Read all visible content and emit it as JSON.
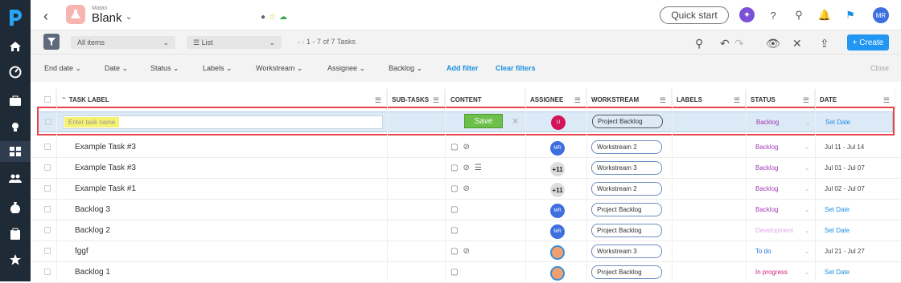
{
  "project": {
    "owner": "Matan",
    "title": "Blank"
  },
  "topbar": {
    "quick_start": "Quick start",
    "user_initials": "MR"
  },
  "toolbar": {
    "view_select": "All items",
    "layout_select": "List",
    "pager": "1 - 7 of 7 Tasks",
    "create": "+ Create"
  },
  "filters": [
    {
      "label": "End date",
      "x": 0
    },
    {
      "label": "Date"
    },
    {
      "label": "Status"
    },
    {
      "label": "Labels"
    },
    {
      "label": "Workstream"
    },
    {
      "label": "Assignee"
    },
    {
      "label": "Backlog"
    }
  ],
  "filter_links": {
    "add": "Add filter",
    "clear": "Clear filters",
    "close": "Close"
  },
  "columns": [
    "TASK LABEL",
    "SUB-TASKS",
    "CONTENT",
    "ASSIGNEE",
    "WORKSTREAM",
    "LABELS",
    "STATUS",
    "DATE"
  ],
  "new_row": {
    "placeholder": "Enter task name",
    "save": "Save",
    "assignee": "U",
    "workstream": "Project Backlog",
    "status": "Backlog",
    "date": "Set Date"
  },
  "rows": [
    {
      "name": "Example Task #3",
      "assignee": "MR",
      "workstream": "Workstream 2",
      "status": "Backlog",
      "date": "Jul 11 - Jul 14"
    },
    {
      "name": "Example Task #3",
      "assignee": "+11",
      "workstream": "Workstream 3",
      "status": "Backlog",
      "date": "Jul 01 - Jul 07"
    },
    {
      "name": "Example Task #1",
      "assignee": "+11",
      "workstream": "Workstream 2",
      "status": "Backlog",
      "date": "Jul 02 - Jul 07"
    },
    {
      "name": "Backlog 3",
      "assignee": "MR",
      "workstream": "Project Backlog",
      "status": "Backlog",
      "date": "Set Date"
    },
    {
      "name": "Backlog 2",
      "assignee": "MR",
      "workstream": "Project Backlog",
      "status": "Development",
      "date": "Set Date"
    },
    {
      "name": "fggf",
      "assignee": "",
      "workstream": "Workstream 3",
      "status": "To do",
      "date": "Jul 21 - Jul 27"
    },
    {
      "name": "Backlog 1",
      "assignee": "",
      "workstream": "Project Backlog",
      "status": "In progress",
      "date": "Set Date"
    }
  ],
  "colors": {
    "backlog": "#a23bb5",
    "development": "#e3a6ec",
    "todo": "#1e73d7",
    "inprogress": "#d1227d",
    "accent": "#2196f3",
    "highlight": "#e8434b"
  }
}
